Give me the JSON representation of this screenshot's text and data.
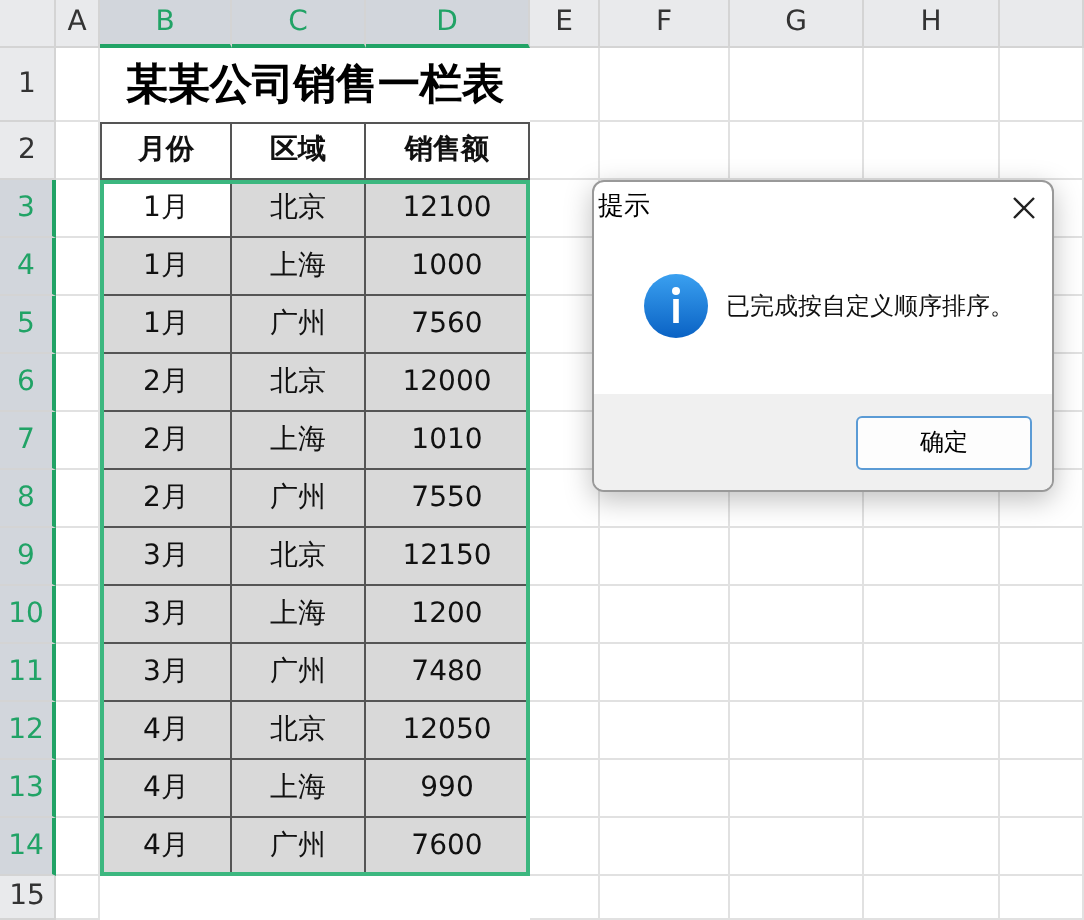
{
  "column_headers": [
    {
      "label": "A",
      "selected": false
    },
    {
      "label": "B",
      "selected": true
    },
    {
      "label": "C",
      "selected": true
    },
    {
      "label": "D",
      "selected": true
    },
    {
      "label": "E",
      "selected": false
    },
    {
      "label": "F",
      "selected": false
    },
    {
      "label": "G",
      "selected": false
    },
    {
      "label": "H",
      "selected": false
    }
  ],
  "row_headers": [
    {
      "label": "1",
      "selected": false
    },
    {
      "label": "2",
      "selected": false
    },
    {
      "label": "3",
      "selected": true
    },
    {
      "label": "4",
      "selected": true
    },
    {
      "label": "5",
      "selected": true
    },
    {
      "label": "6",
      "selected": true
    },
    {
      "label": "7",
      "selected": true
    },
    {
      "label": "8",
      "selected": true
    },
    {
      "label": "9",
      "selected": true
    },
    {
      "label": "10",
      "selected": true
    },
    {
      "label": "11",
      "selected": true
    },
    {
      "label": "12",
      "selected": true
    },
    {
      "label": "13",
      "selected": true
    },
    {
      "label": "14",
      "selected": true
    },
    {
      "label": "15",
      "selected": false
    }
  ],
  "sheet_title": "某某公司销售一栏表",
  "table": {
    "columns": [
      "月份",
      "区域",
      "销售额"
    ],
    "rows": [
      {
        "cells": [
          "1月",
          "北京",
          "12100"
        ],
        "active": true
      },
      {
        "cells": [
          "1月",
          "上海",
          "1000"
        ],
        "active": false
      },
      {
        "cells": [
          "1月",
          "广州",
          "7560"
        ],
        "active": false
      },
      {
        "cells": [
          "2月",
          "北京",
          "12000"
        ],
        "active": false
      },
      {
        "cells": [
          "2月",
          "上海",
          "1010"
        ],
        "active": false
      },
      {
        "cells": [
          "2月",
          "广州",
          "7550"
        ],
        "active": false
      },
      {
        "cells": [
          "3月",
          "北京",
          "12150"
        ],
        "active": false
      },
      {
        "cells": [
          "3月",
          "上海",
          "1200"
        ],
        "active": false
      },
      {
        "cells": [
          "3月",
          "广州",
          "7480"
        ],
        "active": false
      },
      {
        "cells": [
          "4月",
          "北京",
          "12050"
        ],
        "active": false
      },
      {
        "cells": [
          "4月",
          "上海",
          "990"
        ],
        "active": false
      },
      {
        "cells": [
          "4月",
          "广州",
          "7600"
        ],
        "active": false
      }
    ]
  },
  "dialog": {
    "title": "提示",
    "message": "已完成按自定义顺序排序。",
    "button": "确定"
  }
}
